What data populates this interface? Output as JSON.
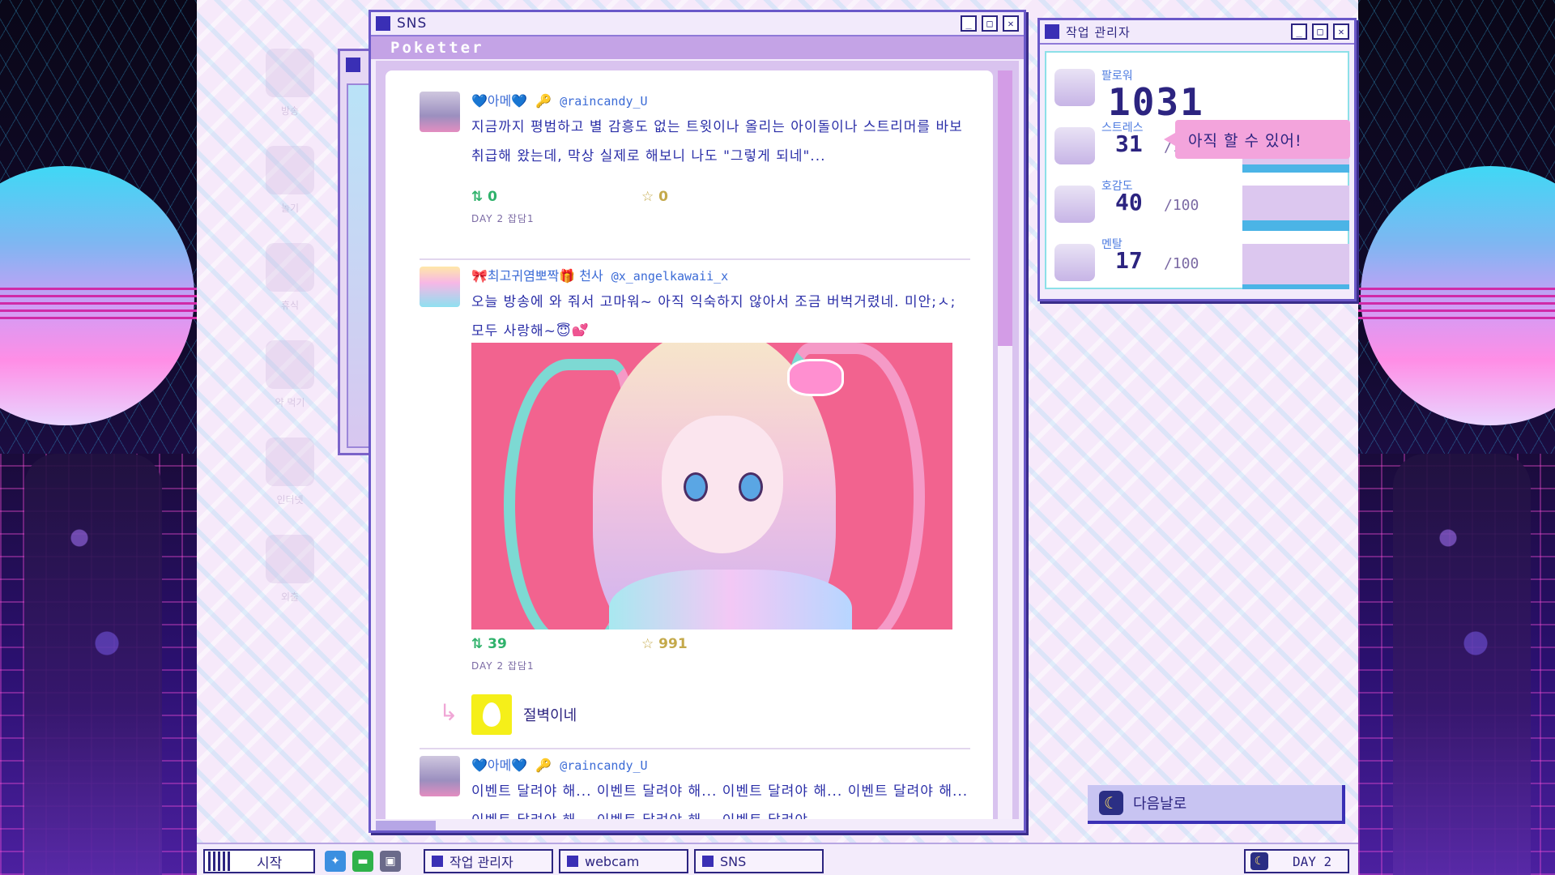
{
  "sns_window": {
    "title": "SNS",
    "app_name": "Poketter",
    "posts": [
      {
        "display_name": "💙아메💙",
        "badge": "🔑",
        "handle": "@raincandy_U",
        "text": "지금까지 평범하고 별 감흥도 없는 트윗이나 올리는 아이돌이나 스트리머를 바보 취급해 왔는데, 막상 실제로 해보니 나도 \"그렇게 되네\"...",
        "retweets": "0",
        "favorites": "0",
        "meta": "DAY 2 잡담1"
      },
      {
        "display_name": "🎀최고귀염뽀짝🎁 천사",
        "handle": "@x_angelkawaii_x",
        "text": "오늘 방송에 와 줘서 고마워~ 아직 익숙하지 않아서 조금 버벅거렸네. 미안;ㅅ; 모두 사랑해~😇💕",
        "retweets": "39",
        "favorites": "991",
        "meta": "DAY 2 잡담1"
      },
      {
        "display_name": "💙아메💙",
        "badge": "🔑",
        "handle": "@raincandy_U",
        "text": "이벤트 달려야 해... 이벤트 달려야 해... 이벤트 달려야 해... 이벤트 달려야 해... 이벤트 달려야 해... 이벤트 달려야 해... 이벤트 달려야"
      }
    ],
    "reply": {
      "name": "절벽이네"
    }
  },
  "task_manager": {
    "title": "작업 관리자",
    "followers_label": "팔로워",
    "followers": "1031",
    "stats": [
      {
        "label": "스트레스",
        "value": "31",
        "max": "/100",
        "level": 0.31
      },
      {
        "label": "호감도",
        "value": "40",
        "max": "/100",
        "level": 0.4
      },
      {
        "label": "멘탈",
        "value": "17",
        "max": "/100",
        "level": 0.17
      }
    ],
    "tooltip": "아직 할 수 있어!"
  },
  "next_day": {
    "label": "다음날로"
  },
  "taskbar": {
    "start": "시작",
    "buttons": [
      "작업 관리자",
      "webcam",
      "SNS"
    ],
    "day": "DAY 2"
  },
  "desktop_icons": [
    "방송",
    "놀기",
    "휴식",
    "약 먹기",
    "인터넷",
    "외출"
  ],
  "colors": {
    "window_border": "#6a58c8",
    "title_square": "#3a2fb5",
    "text": "#2b2fa8",
    "bar_fill": "#4bb4e6",
    "tooltip": "#f3a4dc"
  }
}
